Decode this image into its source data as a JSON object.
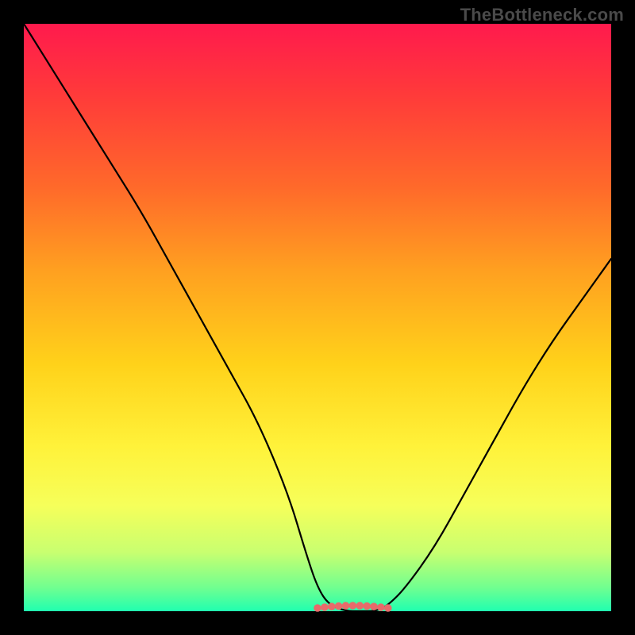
{
  "watermark": "TheBottleneck.com",
  "colors": {
    "frame": "#000000",
    "gradient_top": "#ff1a4d",
    "gradient_bottom": "#20ffb0",
    "curve": "#000000",
    "accent_dots": "#e86a6a"
  },
  "chart_data": {
    "type": "line",
    "title": "",
    "xlabel": "",
    "ylabel": "",
    "xlim": [
      0,
      100
    ],
    "ylim": [
      0,
      100
    ],
    "grid": false,
    "legend": false,
    "annotations": [
      "TheBottleneck.com"
    ],
    "series": [
      {
        "name": "bottleneck-curve",
        "x": [
          0,
          5,
          10,
          15,
          20,
          25,
          30,
          35,
          40,
          45,
          48,
          50,
          52,
          55,
          57,
          60,
          62,
          65,
          70,
          75,
          80,
          85,
          90,
          95,
          100
        ],
        "y": [
          100,
          92,
          84,
          76,
          68,
          59,
          50,
          41,
          32,
          20,
          10,
          4,
          1,
          0,
          0,
          0,
          1,
          4,
          11,
          20,
          29,
          38,
          46,
          53,
          60
        ]
      }
    ],
    "accent_segment": {
      "name": "flat-bottom-highlight",
      "x_start": 50,
      "x_end": 62,
      "y": 0
    }
  }
}
